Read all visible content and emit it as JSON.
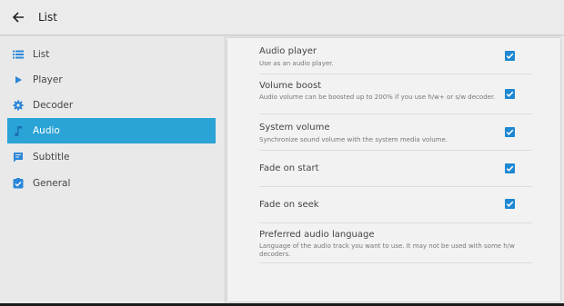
{
  "appbar": {
    "title": "List"
  },
  "sidebar": {
    "items": [
      {
        "label": "List",
        "icon": "list-icon"
      },
      {
        "label": "Player",
        "icon": "play-icon"
      },
      {
        "label": "Decoder",
        "icon": "gear-icon"
      },
      {
        "label": "Audio",
        "icon": "music-note-icon",
        "active": true
      },
      {
        "label": "Subtitle",
        "icon": "subtitle-icon"
      },
      {
        "label": "General",
        "icon": "checkbox-badge-icon"
      }
    ]
  },
  "settings": {
    "items": [
      {
        "title": "Audio player",
        "subtitle": "Use as an audio player.",
        "checked": true
      },
      {
        "title": "Volume boost",
        "subtitle": "Audio volume can be boosted up to 200% if you use h/w+ or s/w decoder.",
        "checked": true
      },
      {
        "title": "System volume",
        "subtitle": "Synchronize sound volume with the system media volume.",
        "checked": true
      },
      {
        "title": "Fade on start",
        "subtitle": "",
        "checked": true
      },
      {
        "title": "Fade on seek",
        "subtitle": "",
        "checked": true
      },
      {
        "title": "Preferred audio language",
        "subtitle": "Language of the audio track you want to use. It may not be used with some h/w decoders."
      }
    ]
  },
  "colors": {
    "accent": "#2aa3d6",
    "checkbox": "#1e88d2",
    "background": "#e9e9e9",
    "panel": "#f2f2f2"
  }
}
